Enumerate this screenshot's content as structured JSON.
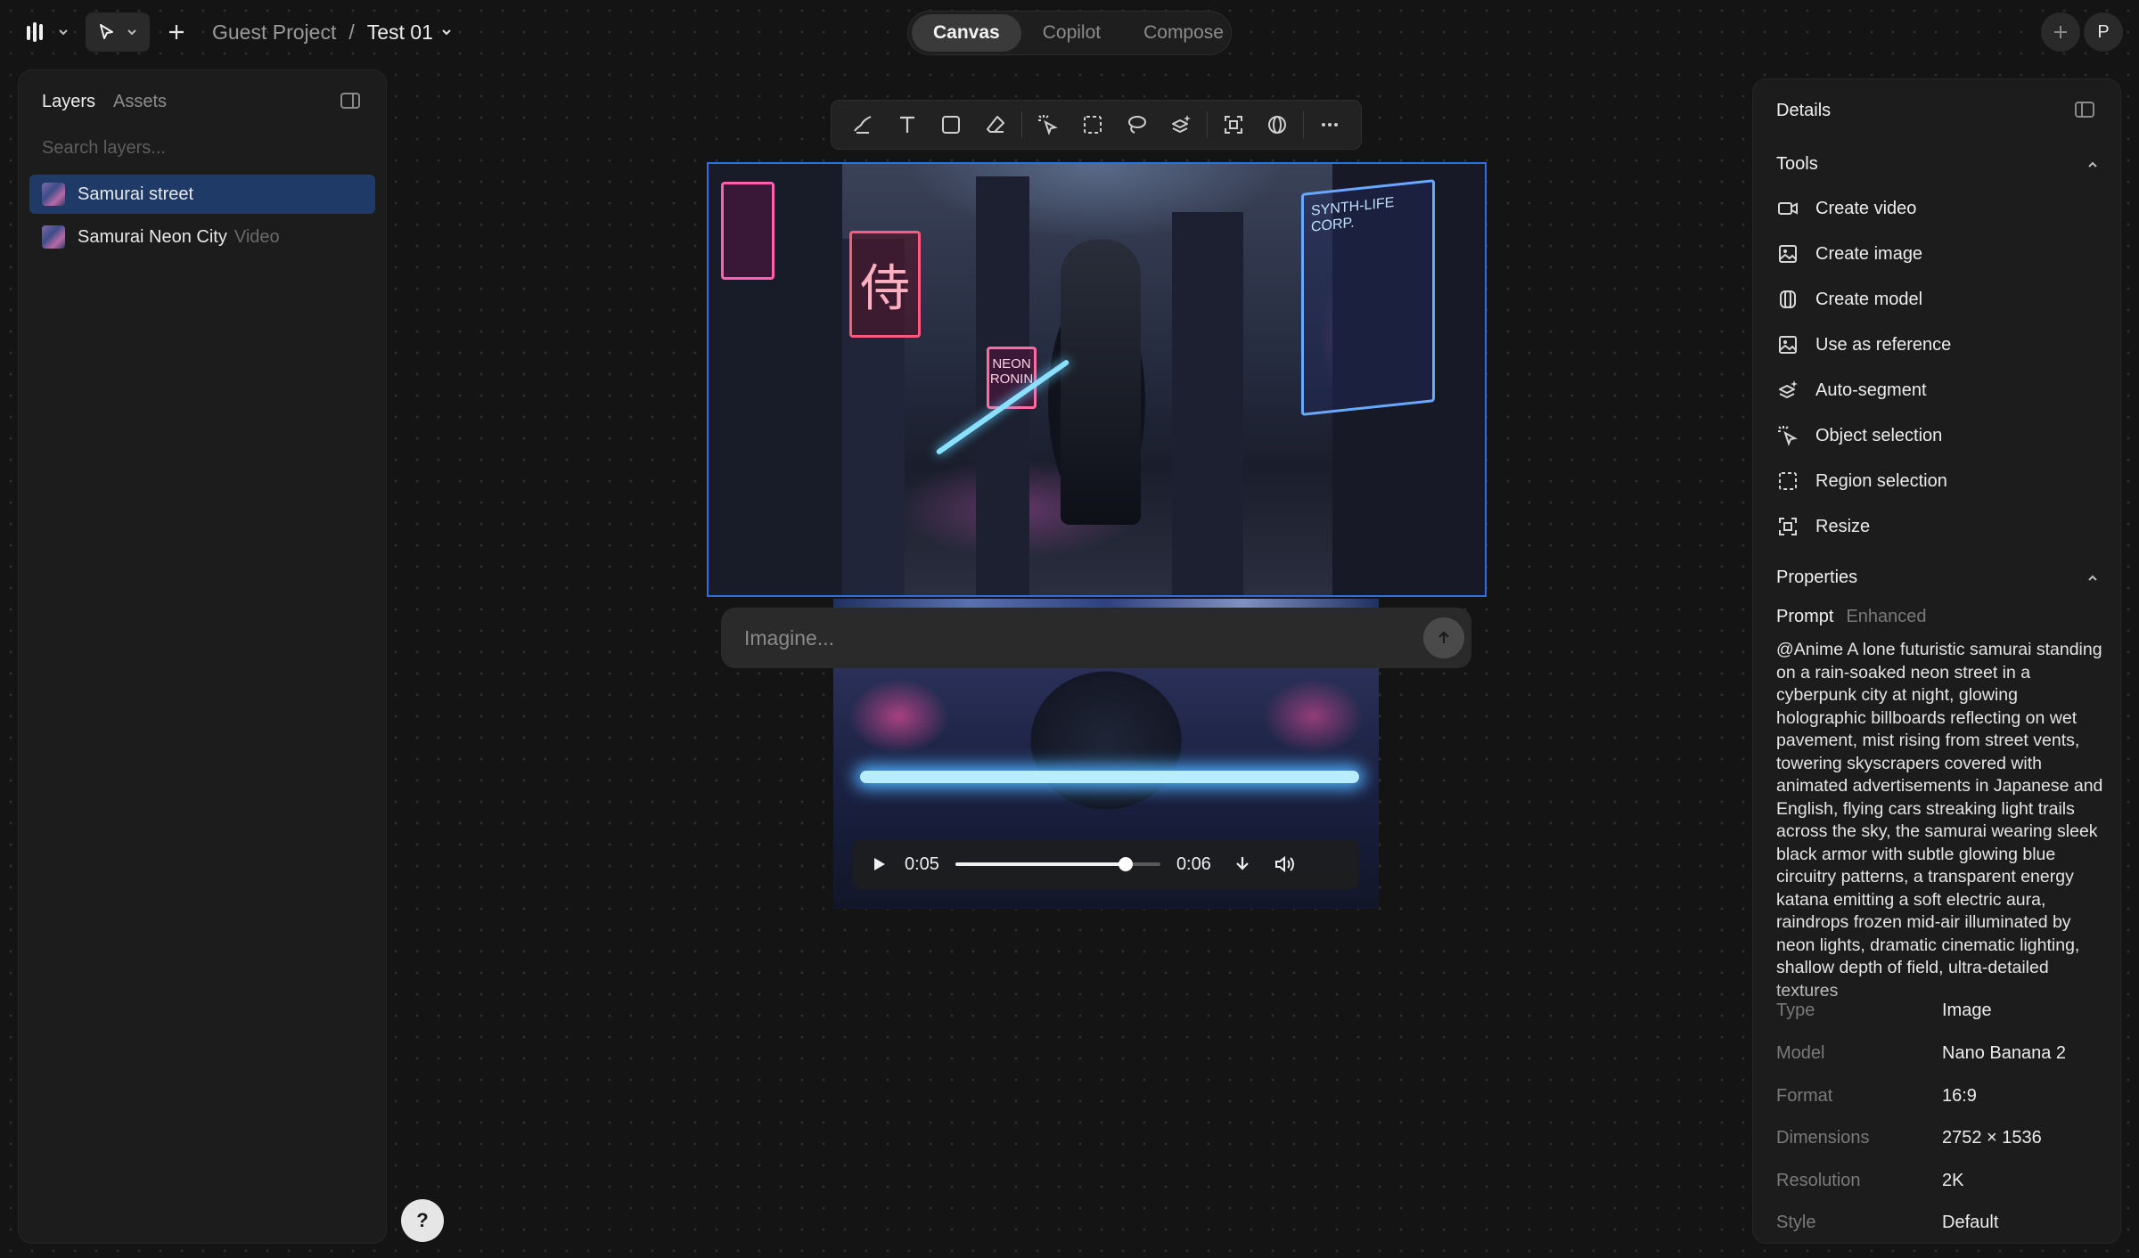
{
  "topbar": {
    "project_name": "Guest Project",
    "separator": "/",
    "file_name": "Test 01",
    "modes": [
      "Canvas",
      "Copilot",
      "Compose"
    ],
    "active_mode": "Canvas",
    "avatar_initial": "P"
  },
  "left_panel": {
    "tabs": [
      "Layers",
      "Assets"
    ],
    "search_placeholder": "Search layers...",
    "layers": [
      {
        "name": "Samurai street",
        "tag": "",
        "selected": true
      },
      {
        "name": "Samurai Neon City",
        "tag": "Video",
        "selected": false
      }
    ]
  },
  "canvas": {
    "image_signs": {
      "samurai_kanji": "侍",
      "neon_ronin": "NEON RONIN",
      "synth_corp": "SYNTH-LIFE CORP."
    },
    "prompt_placeholder": "Imagine...",
    "video": {
      "current_time": "0:05",
      "duration": "0:06",
      "progress": 0.83
    }
  },
  "help_label": "?",
  "right_panel": {
    "title": "Details",
    "tools_heading": "Tools",
    "tools": [
      {
        "label": "Create video",
        "icon": "video-icon"
      },
      {
        "label": "Create image",
        "icon": "image-icon"
      },
      {
        "label": "Create model",
        "icon": "model-icon"
      },
      {
        "label": "Use as reference",
        "icon": "reference-icon"
      },
      {
        "label": "Auto-segment",
        "icon": "auto-segment-icon"
      },
      {
        "label": "Object selection",
        "icon": "object-selection-icon"
      },
      {
        "label": "Region selection",
        "icon": "region-selection-icon"
      },
      {
        "label": "Resize",
        "icon": "resize-icon"
      }
    ],
    "properties_heading": "Properties",
    "prompt_tab": "Prompt",
    "enhanced_tab": "Enhanced",
    "prompt_text": "@Anime A lone futuristic samurai standing on a rain-soaked neon street in a cyberpunk city at night, glowing holographic billboards reflecting on wet pavement, mist rising from street vents, towering skyscrapers covered with animated advertisements in Japanese and English, flying cars streaking light trails across the sky, the samurai wearing sleek black armor with subtle glowing blue circuitry patterns, a transparent energy katana emitting a soft electric aura, raindrops frozen mid-air illuminated by neon lights, dramatic cinematic lighting, shallow depth of field, ultra-detailed textures",
    "properties": [
      {
        "key": "Type",
        "value": "Image"
      },
      {
        "key": "Model",
        "value": "Nano Banana 2"
      },
      {
        "key": "Format",
        "value": "16:9"
      },
      {
        "key": "Dimensions",
        "value": "2752 × 1536"
      },
      {
        "key": "Resolution",
        "value": "2K"
      },
      {
        "key": "Style",
        "value": "Default"
      }
    ]
  },
  "colors": {
    "accent": "#2f6fe0",
    "selected_layer": "#1f3a66",
    "background": "#141414",
    "panel": "#1c1c1c"
  }
}
